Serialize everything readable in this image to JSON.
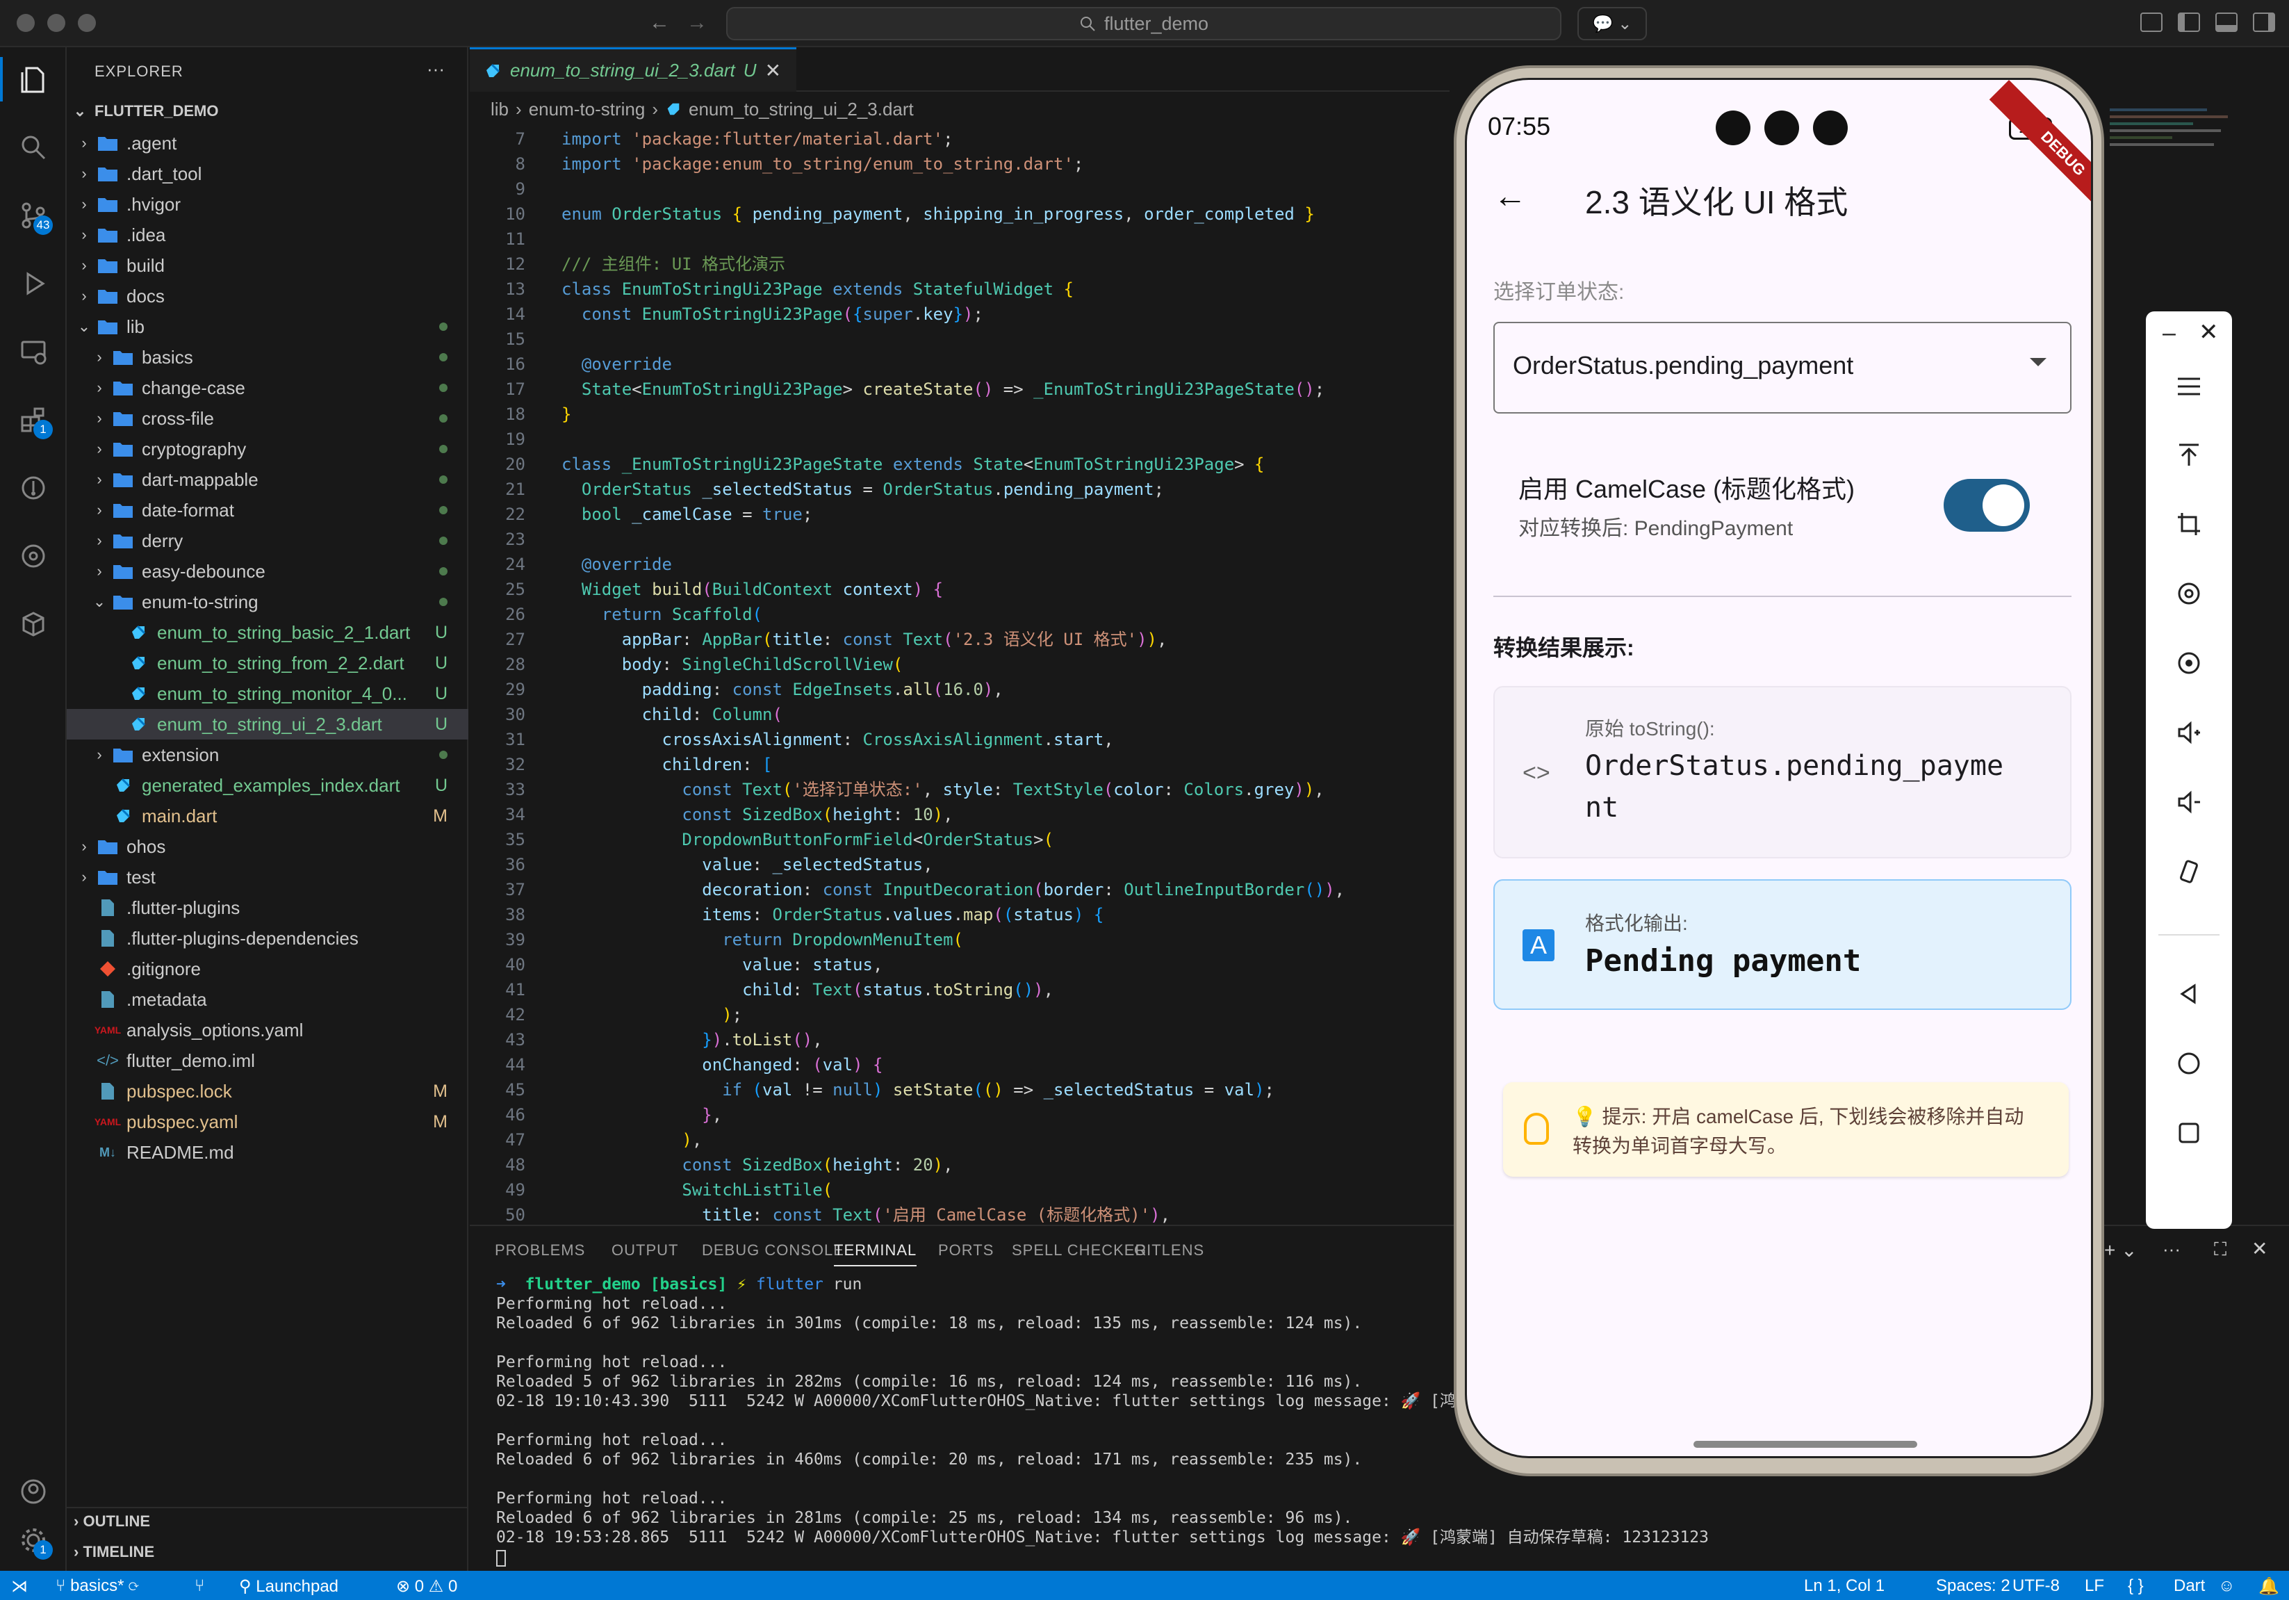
{
  "titlebar": {
    "search": "flutter_demo"
  },
  "activity": {
    "scm_badge": "43",
    "ext_badge": "1",
    "settings_badge": "1"
  },
  "explorer": {
    "header": "EXPLORER",
    "more": "···",
    "root": "FLUTTER_DEMO",
    "items": [
      {
        "label": ".agent",
        "type": "folder",
        "depth": 0,
        "open": false,
        "status": ""
      },
      {
        "label": ".dart_tool",
        "type": "folder",
        "depth": 0,
        "open": false,
        "status": ""
      },
      {
        "label": ".hvigor",
        "type": "folder",
        "depth": 0,
        "open": false,
        "status": ""
      },
      {
        "label": ".idea",
        "type": "folder",
        "depth": 0,
        "open": false,
        "status": ""
      },
      {
        "label": "build",
        "type": "folder",
        "depth": 0,
        "open": false,
        "status": ""
      },
      {
        "label": "docs",
        "type": "folder",
        "depth": 0,
        "open": false,
        "status": ""
      },
      {
        "label": "lib",
        "type": "folder",
        "depth": 0,
        "open": true,
        "status": "dot"
      },
      {
        "label": "basics",
        "type": "folder",
        "depth": 1,
        "open": false,
        "status": "dot"
      },
      {
        "label": "change-case",
        "type": "folder",
        "depth": 1,
        "open": false,
        "status": "dot"
      },
      {
        "label": "cross-file",
        "type": "folder",
        "depth": 1,
        "open": false,
        "status": "dot"
      },
      {
        "label": "cryptography",
        "type": "folder",
        "depth": 1,
        "open": false,
        "status": "dot"
      },
      {
        "label": "dart-mappable",
        "type": "folder",
        "depth": 1,
        "open": false,
        "status": "dot"
      },
      {
        "label": "date-format",
        "type": "folder",
        "depth": 1,
        "open": false,
        "status": "dot"
      },
      {
        "label": "derry",
        "type": "folder",
        "depth": 1,
        "open": false,
        "status": "dot"
      },
      {
        "label": "easy-debounce",
        "type": "folder",
        "depth": 1,
        "open": false,
        "status": "dot"
      },
      {
        "label": "enum-to-string",
        "type": "folder",
        "depth": 1,
        "open": true,
        "status": "dot"
      },
      {
        "label": "enum_to_string_basic_2_1.dart",
        "type": "dart",
        "depth": 2,
        "status": "U"
      },
      {
        "label": "enum_to_string_from_2_2.dart",
        "type": "dart",
        "depth": 2,
        "status": "U"
      },
      {
        "label": "enum_to_string_monitor_4_0...",
        "type": "dart",
        "depth": 2,
        "status": "U"
      },
      {
        "label": "enum_to_string_ui_2_3.dart",
        "type": "dart",
        "depth": 2,
        "status": "U",
        "selected": true
      },
      {
        "label": "extension",
        "type": "folder",
        "depth": 1,
        "open": false,
        "status": "dot"
      },
      {
        "label": "generated_examples_index.dart",
        "type": "dart",
        "depth": 1,
        "status": "U"
      },
      {
        "label": "main.dart",
        "type": "dart",
        "depth": 1,
        "status": "M"
      },
      {
        "label": "ohos",
        "type": "folder",
        "depth": 0,
        "open": false,
        "status": ""
      },
      {
        "label": "test",
        "type": "folder",
        "depth": 0,
        "open": false,
        "status": ""
      },
      {
        "label": ".flutter-plugins",
        "type": "file",
        "depth": 0,
        "status": ""
      },
      {
        "label": ".flutter-plugins-dependencies",
        "type": "file",
        "depth": 0,
        "status": ""
      },
      {
        "label": ".gitignore",
        "type": "git",
        "depth": 0,
        "status": ""
      },
      {
        "label": ".metadata",
        "type": "file",
        "depth": 0,
        "status": ""
      },
      {
        "label": "analysis_options.yaml",
        "type": "yaml",
        "depth": 0,
        "status": ""
      },
      {
        "label": "flutter_demo.iml",
        "type": "xml",
        "depth": 0,
        "status": ""
      },
      {
        "label": "pubspec.lock",
        "type": "file",
        "depth": 0,
        "status": "M"
      },
      {
        "label": "pubspec.yaml",
        "type": "yaml",
        "depth": 0,
        "status": "M"
      },
      {
        "label": "README.md",
        "type": "md",
        "depth": 0,
        "status": ""
      }
    ],
    "outline": "OUTLINE",
    "timeline": "TIMELINE"
  },
  "editor": {
    "tab_label": "enum_to_string_ui_2_3.dart",
    "tab_status": "U",
    "crumbs": [
      "lib",
      "enum-to-string",
      "enum_to_string_ui_2_3.dart"
    ],
    "line_numbers": [
      "7",
      "8",
      "9",
      "10",
      "11",
      "12",
      "13",
      "14",
      "15",
      "16",
      "17",
      "18",
      "19",
      "20",
      "21",
      "22",
      "23",
      "24",
      "25",
      "26",
      "27",
      "28",
      "29",
      "30",
      "31",
      "32",
      "33",
      "34",
      "35",
      "36",
      "37",
      "38",
      "39",
      "40",
      "41",
      "42",
      "43",
      "44",
      "45",
      "46",
      "47",
      "48",
      "49",
      "50"
    ]
  },
  "panel": {
    "tabs": [
      "PROBLEMS",
      "OUTPUT",
      "DEBUG CONSOLE",
      "TERMINAL",
      "PORTS",
      "SPELL CHECKER",
      "GITLENS"
    ],
    "active": "TERMINAL",
    "prompt_dir": "flutter_demo",
    "prompt_branch": "[basics]",
    "prompt_cmd": "flutter",
    "prompt_arg": "run",
    "lines": [
      "Performing hot reload...",
      "Reloaded 6 of 962 libraries in 301ms (compile: 18 ms, reload: 135 ms, reassemble: 124 ms).",
      "",
      "Performing hot reload...",
      "Reloaded 5 of 962 libraries in 282ms (compile: 16 ms, reload: 124 ms, reassemble: 116 ms).",
      "02-18 19:10:43.390  5111  5242 W A00000/XComFlutterOHOS_Native: flutter settings log message: 🚀 [鸿",
      "",
      "Performing hot reload...",
      "Reloaded 6 of 962 libraries in 460ms (compile: 20 ms, reload: 171 ms, reassemble: 235 ms).",
      "",
      "Performing hot reload...",
      "Reloaded 6 of 962 libraries in 281ms (compile: 25 ms, reload: 134 ms, reassemble: 96 ms).",
      "02-18 19:53:28.865  5111  5242 W A00000/XComFlutterOHOS_Native: flutter settings log message: 🚀 [鸿蒙端] 自动保存草稿: 123123123",
      ""
    ]
  },
  "statusbar": {
    "branch": "basics*",
    "launchpad": "Launchpad",
    "errors": "0",
    "warnings": "0",
    "position": "Ln 1, Col 1",
    "spaces": "Spaces: 2",
    "encoding": "UTF-8",
    "eol": "LF",
    "lang_braces": "{ }",
    "language": "Dart"
  },
  "phone": {
    "time": "07:55",
    "battery": "100",
    "debug_banner": "DEBUG",
    "appbar_title": "2.3 语义化 UI 格式",
    "select_label": "选择订单状态:",
    "dropdown_value": "OrderStatus.pending_payment",
    "switch_title": "启用 CamelCase (标题化格式)",
    "switch_subtitle": "对应转换后: PendingPayment",
    "switch_on": true,
    "result_heading": "转换结果展示:",
    "raw_label": "原始 toString():",
    "raw_value_1": "OrderStatus.pending_payme",
    "raw_value_2": "nt",
    "fmt_label": "格式化输出:",
    "fmt_value": "Pending payment",
    "fmt_icon_letter": "A",
    "tip_line1": "💡 提示: 开启 camelCase 后, 下划线会被移除并自动",
    "tip_line2": "转换为单词首字母大写。"
  },
  "colors": {
    "accent": "#0078d4",
    "selection": "#37373d",
    "untracked": "#73c991",
    "modified": "#e2c08d",
    "switch": "#1f5f8b"
  }
}
